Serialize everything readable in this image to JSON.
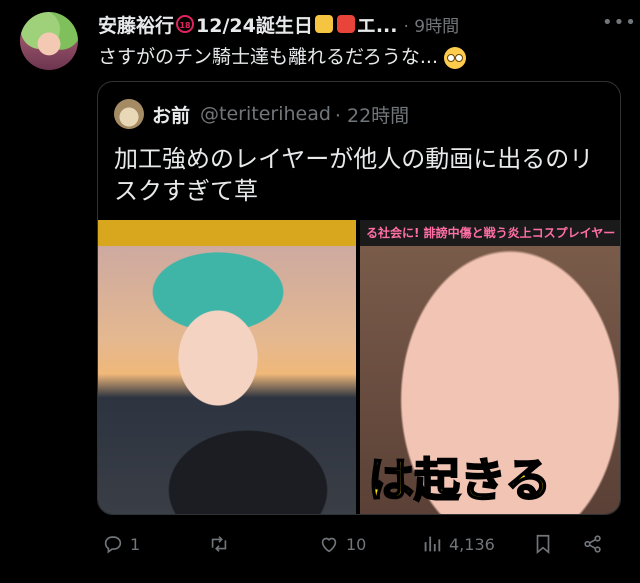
{
  "post": {
    "author": {
      "name_prefix": "安藤裕行",
      "age_badge": "18",
      "name_suffix": "12/24誕生日",
      "name_tail": "エ...",
      "time": "· 9時間"
    },
    "text": "さすがのチン騎士達も離れるだろうな...",
    "quote": {
      "name": "お前",
      "handle": "@teriterihead",
      "time": "· 22時間",
      "text": "加工強めのレイヤーが他人の動画に出るのリスクすぎて草",
      "right_image_caption_top": "る社会に! 誹謗中傷と戦う炎上コスプレイヤー",
      "right_image_caption_big": "は起きる"
    },
    "actions": {
      "replies": "1",
      "retweets": "",
      "likes": "10",
      "views": "4,136"
    }
  },
  "icons": {
    "more": "more-icon",
    "reply": "reply-icon",
    "retweet": "retweet-icon",
    "like": "heart-icon",
    "views": "views-icon",
    "bookmark": "bookmark-icon",
    "share": "share-icon"
  }
}
